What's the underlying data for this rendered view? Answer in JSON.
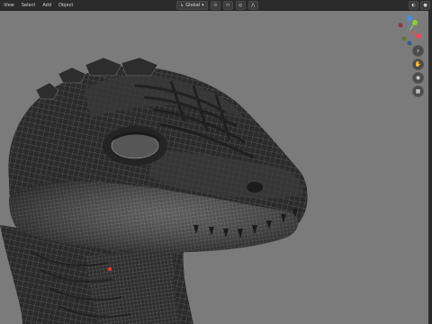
{
  "header": {
    "menu": [
      "View",
      "Select",
      "Add",
      "Object"
    ],
    "orientation": "Global"
  },
  "gizmo": {
    "axes": [
      {
        "label": "X",
        "color": "#e8485a"
      },
      {
        "label": "Y",
        "color": "#8ccd3e"
      },
      {
        "label": "Z",
        "color": "#4a8fe8"
      }
    ]
  },
  "colors": {
    "viewport": "#7b7b7b",
    "header": "#2b2b2b",
    "mesh": "#2a2a2a",
    "wire": "#9a9a9a"
  }
}
